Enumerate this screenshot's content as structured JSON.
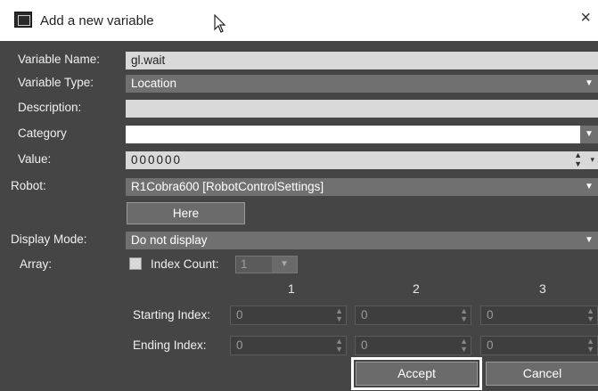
{
  "window": {
    "title": "Add a new variable",
    "close_glyph": "×"
  },
  "form": {
    "variable_name": {
      "label": "Variable Name:",
      "value": "gl.wait"
    },
    "variable_type": {
      "label": "Variable Type:",
      "value": "Location"
    },
    "description": {
      "label": "Description:",
      "value": ""
    },
    "category": {
      "label": "Category",
      "value": ""
    },
    "value": {
      "label": "Value:",
      "value": "000000"
    },
    "robot": {
      "label": "Robot:",
      "value": "R1Cobra600 [RobotControlSettings]"
    },
    "here_button": "Here",
    "display_mode": {
      "label": "Display Mode:",
      "value": "Do not display"
    },
    "array": {
      "label": "Array:",
      "index_count_label": "Index Count:",
      "index_count_value": "1"
    },
    "columns": [
      "1",
      "2",
      "3"
    ],
    "starting_index": {
      "label": "Starting Index:",
      "values": [
        "0",
        "0",
        "0"
      ]
    },
    "ending_index": {
      "label": "Ending Index:",
      "values": [
        "0",
        "0",
        "0"
      ]
    }
  },
  "buttons": {
    "accept": "Accept",
    "cancel": "Cancel"
  },
  "colors": {
    "background": "#454545",
    "field": "#d9d9d9",
    "dropdown": "#707070",
    "titlebar": "#ffffff"
  }
}
